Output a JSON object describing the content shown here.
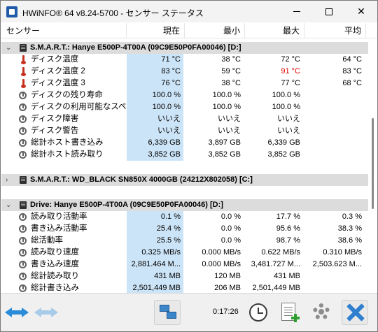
{
  "window": {
    "title": "HWiNFO® 64 v8.24-5700 - センサー ステータス",
    "minimize": "minimize",
    "maximize": "maximize",
    "close": "close"
  },
  "columns": {
    "name": "センサー",
    "current": "現在",
    "min": "最小",
    "max": "最大",
    "avg": "平均"
  },
  "groups": [
    {
      "title": "S.M.A.R.T.: Hanye E500P-4T00A (09C9E50P0FA00046) [D:]",
      "expanded": true,
      "rows": [
        {
          "icon": "thermometer-icon",
          "name": "ディスク温度",
          "current": "71 °C",
          "min": "38 °C",
          "max": "72 °C",
          "avg": "64 °C"
        },
        {
          "icon": "thermometer-icon",
          "name": "ディスク温度 2",
          "current": "83 °C",
          "min": "59 °C",
          "max": "91 °C",
          "avg": "83 °C",
          "max_red": true
        },
        {
          "icon": "thermometer-icon",
          "name": "ディスク温度 3",
          "current": "76 °C",
          "min": "38 °C",
          "max": "77 °C",
          "avg": "68 °C"
        },
        {
          "icon": "gauge-icon",
          "name": "ディスクの残り寿命",
          "current": "100.0 %",
          "min": "100.0 %",
          "max": "100.0 %",
          "avg": ""
        },
        {
          "icon": "gauge-icon",
          "name": "ディスクの利用可能なスペア",
          "current": "100.0 %",
          "min": "100.0 %",
          "max": "100.0 %",
          "avg": ""
        },
        {
          "icon": "gauge-icon",
          "name": "ディスク障害",
          "current": "いいえ",
          "min": "いいえ",
          "max": "いいえ",
          "avg": ""
        },
        {
          "icon": "gauge-icon",
          "name": "ディスク警告",
          "current": "いいえ",
          "min": "いいえ",
          "max": "いいえ",
          "avg": ""
        },
        {
          "icon": "gauge-icon",
          "name": "総計ホスト書き込み",
          "current": "6,339 GB",
          "min": "3,897 GB",
          "max": "6,339 GB",
          "avg": ""
        },
        {
          "icon": "gauge-icon",
          "name": "総計ホスト読み取り",
          "current": "3,852 GB",
          "min": "3,852 GB",
          "max": "3,852 GB",
          "avg": ""
        }
      ]
    },
    {
      "title": "S.M.A.R.T.: WD_BLACK SN850X 4000GB (24212X802058) [C:]",
      "expanded": false,
      "rows": []
    },
    {
      "title": "Drive: Hanye E500P-4T00A (09C9E50P0FA00046) [D:]",
      "expanded": true,
      "rows": [
        {
          "icon": "gauge-icon",
          "name": "読み取り活動率",
          "current": "0.1 %",
          "min": "0.0 %",
          "max": "17.7 %",
          "avg": "0.3 %"
        },
        {
          "icon": "gauge-icon",
          "name": "書き込み活動率",
          "current": "25.4 %",
          "min": "0.0 %",
          "max": "95.6 %",
          "avg": "38.3 %"
        },
        {
          "icon": "gauge-icon",
          "name": "総活動率",
          "current": "25.5 %",
          "min": "0.0 %",
          "max": "98.7 %",
          "avg": "38.6 %"
        },
        {
          "icon": "gauge-icon",
          "name": "読み取り速度",
          "current": "0.325 MB/s",
          "min": "0.000 MB/s",
          "max": "0.622 MB/s",
          "avg": "0.310 MB/s"
        },
        {
          "icon": "gauge-icon",
          "name": "書き込み速度",
          "current": "2,881.464 M...",
          "min": "0.000 MB/s",
          "max": "3,481.727 M...",
          "avg": "2,503.623 M..."
        },
        {
          "icon": "gauge-icon",
          "name": "総計読み取り",
          "current": "431 MB",
          "min": "120 MB",
          "max": "431 MB",
          "avg": ""
        },
        {
          "icon": "gauge-icon",
          "name": "総計書き込み",
          "current": "2,501,449 MB",
          "min": "206 MB",
          "max": "2,501,449 MB",
          "avg": ""
        }
      ]
    }
  ],
  "toolbar": {
    "elapsed_time": "0:17:26"
  }
}
